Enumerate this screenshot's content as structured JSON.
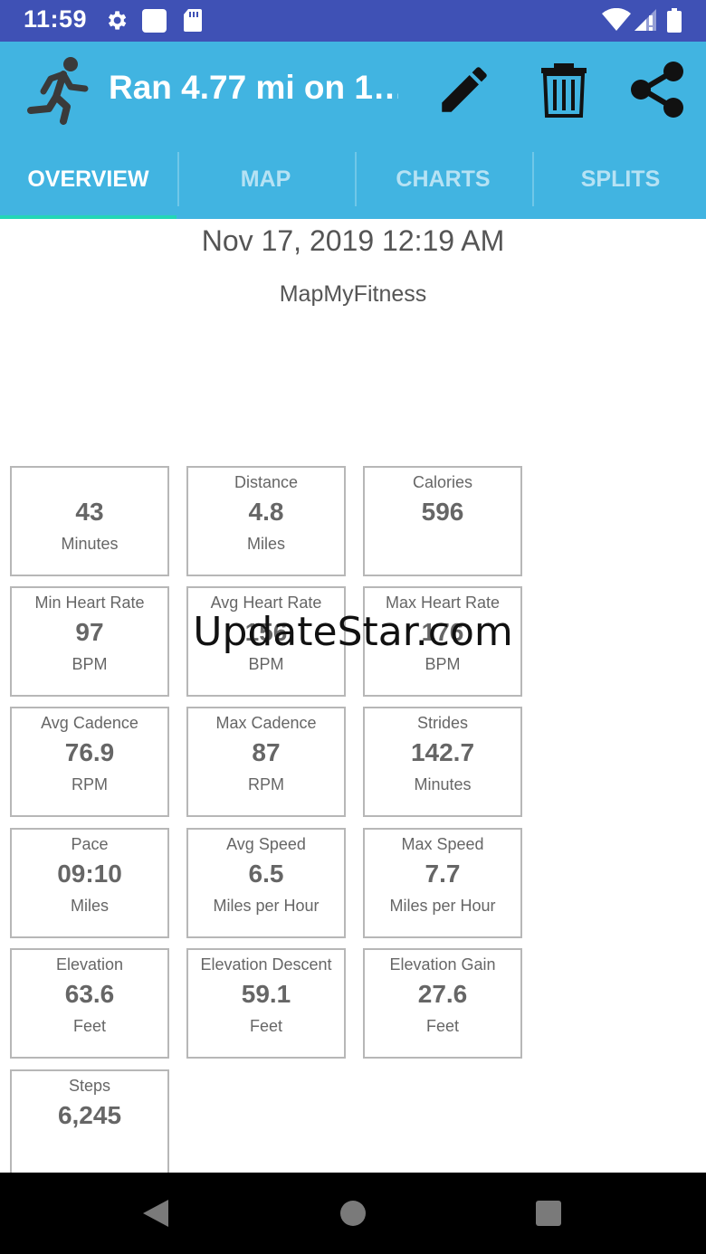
{
  "status_bar": {
    "time": "11:59",
    "icons": [
      "gear-icon",
      "square-icon",
      "sd-card-icon",
      "wifi-icon",
      "signal-icon",
      "battery-icon"
    ]
  },
  "app_bar": {
    "title": "Ran 4.77 mi on 1…",
    "icon": "running-person-icon",
    "actions": [
      "pencil-icon",
      "trash-icon",
      "share-icon"
    ]
  },
  "tabs": [
    {
      "label": "OVERVIEW",
      "active": true
    },
    {
      "label": "MAP",
      "active": false
    },
    {
      "label": "CHARTS",
      "active": false
    },
    {
      "label": "SPLITS",
      "active": false
    }
  ],
  "header": {
    "date": "Nov 17, 2019 12:19 AM",
    "source": "MapMyFitness"
  },
  "stats": [
    {
      "label": "",
      "value": "43",
      "unit": "Minutes"
    },
    {
      "label": "Distance",
      "value": "4.8",
      "unit": "Miles"
    },
    {
      "label": "Calories",
      "value": "596",
      "unit": ""
    },
    {
      "label": "Min Heart Rate",
      "value": "97",
      "unit": "BPM"
    },
    {
      "label": "Avg Heart Rate",
      "value": "156",
      "unit": "BPM"
    },
    {
      "label": "Max Heart Rate",
      "value": "176",
      "unit": "BPM"
    },
    {
      "label": "Avg Cadence",
      "value": "76.9",
      "unit": "RPM"
    },
    {
      "label": "Max Cadence",
      "value": "87",
      "unit": "RPM"
    },
    {
      "label": "Strides",
      "value": "142.7",
      "unit": "Minutes"
    },
    {
      "label": "Pace",
      "value": "09:10",
      "unit": "Miles"
    },
    {
      "label": "Avg Speed",
      "value": "6.5",
      "unit": "Miles per Hour"
    },
    {
      "label": "Max Speed",
      "value": "7.7",
      "unit": "Miles per Hour"
    },
    {
      "label": "Elevation",
      "value": "63.6",
      "unit": "Feet"
    },
    {
      "label": "Elevation Descent",
      "value": "59.1",
      "unit": "Feet"
    },
    {
      "label": "Elevation Gain",
      "value": "27.6",
      "unit": "Feet"
    },
    {
      "label": "Steps",
      "value": "6,245",
      "unit": ""
    }
  ],
  "watermark": "UpdateStar.com",
  "colors": {
    "status_bar": "#3f51b5",
    "app_bar": "#41b4e1",
    "tab_indicator": "#23d6b6",
    "nav_bar": "#000000"
  }
}
